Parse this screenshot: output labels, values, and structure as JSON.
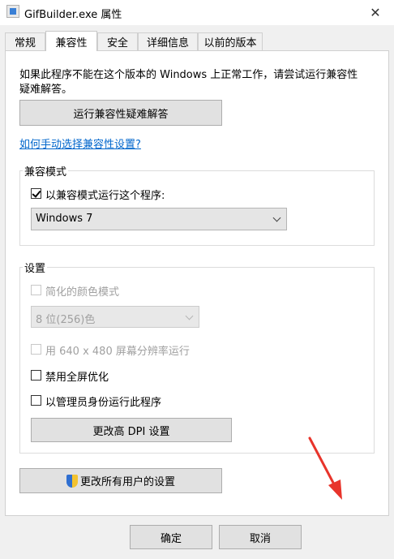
{
  "window": {
    "title": "GifBuilder.exe 属性",
    "close": "✕"
  },
  "tabs": [
    {
      "label": "常规"
    },
    {
      "label": "兼容性"
    },
    {
      "label": "安全"
    },
    {
      "label": "详细信息"
    },
    {
      "label": "以前的版本"
    }
  ],
  "intro": {
    "line1": "如果此程序不能在这个版本的 Windows 上正常工作，请尝试运行兼容性",
    "line2": "疑难解答。"
  },
  "troubleshoot_button": "运行兼容性疑难解答",
  "manual_link": "如何手动选择兼容性设置?",
  "compat_mode": {
    "group_label": "兼容模式",
    "checkbox_label": "以兼容模式运行这个程序:",
    "selected_os": "Windows 7"
  },
  "settings": {
    "group_label": "设置",
    "reduced_color": "简化的颜色模式",
    "color_depth": "8 位(256)色",
    "low_res": "用 640 x 480 屏幕分辨率运行",
    "disable_fullscreen": "禁用全屏优化",
    "run_as_admin": "以管理员身份运行此程序",
    "dpi_button": "更改高 DPI 设置"
  },
  "all_users_button": "更改所有用户的设置",
  "footer": {
    "ok": "确定",
    "cancel": "取消"
  },
  "colors": {
    "link": "#0066cc",
    "arrow": "#e8342b",
    "panel": "#ffffff",
    "window": "#f0f0f0"
  }
}
